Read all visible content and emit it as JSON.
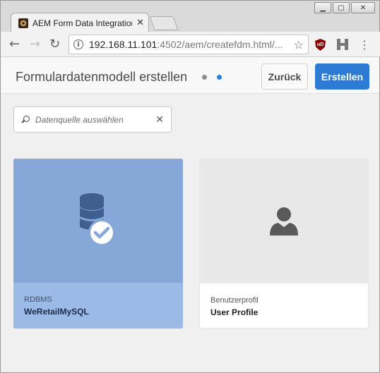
{
  "browser": {
    "tab_title": "AEM Form Data Integration",
    "tab_close": "✕",
    "url_host": "192.168.11.101",
    "url_rest": ":4502/aem/createfdm.html/...",
    "window_buttons": {
      "minimize": "▁",
      "maximize": "▢",
      "close": "✕"
    },
    "ublock_badge": "uD",
    "icons": [
      "back-icon",
      "forward-icon",
      "reload-icon",
      "info-icon",
      "star-icon",
      "ublock-icon",
      "extension-h-icon",
      "menu-icon"
    ]
  },
  "header": {
    "title": "Formulardatenmodell erstellen",
    "back_label": "Zurück",
    "create_label": "Erstellen",
    "steps": 2,
    "active_step": 2
  },
  "search": {
    "placeholder": "Datenquelle auswählen",
    "value": ""
  },
  "cards": [
    {
      "subtitle": "RDBMS",
      "title": "WeRetailMySQL",
      "selected": true,
      "icon": "database-check-icon"
    },
    {
      "subtitle": "Benutzerprofil",
      "title": "User Profile",
      "selected": false,
      "icon": "user-icon"
    }
  ],
  "colors": {
    "accent": "#2d7bd4",
    "selected_card": "#9bbbe6",
    "selected_thumb": "#85a8d8",
    "active_step": "#2680eb"
  }
}
